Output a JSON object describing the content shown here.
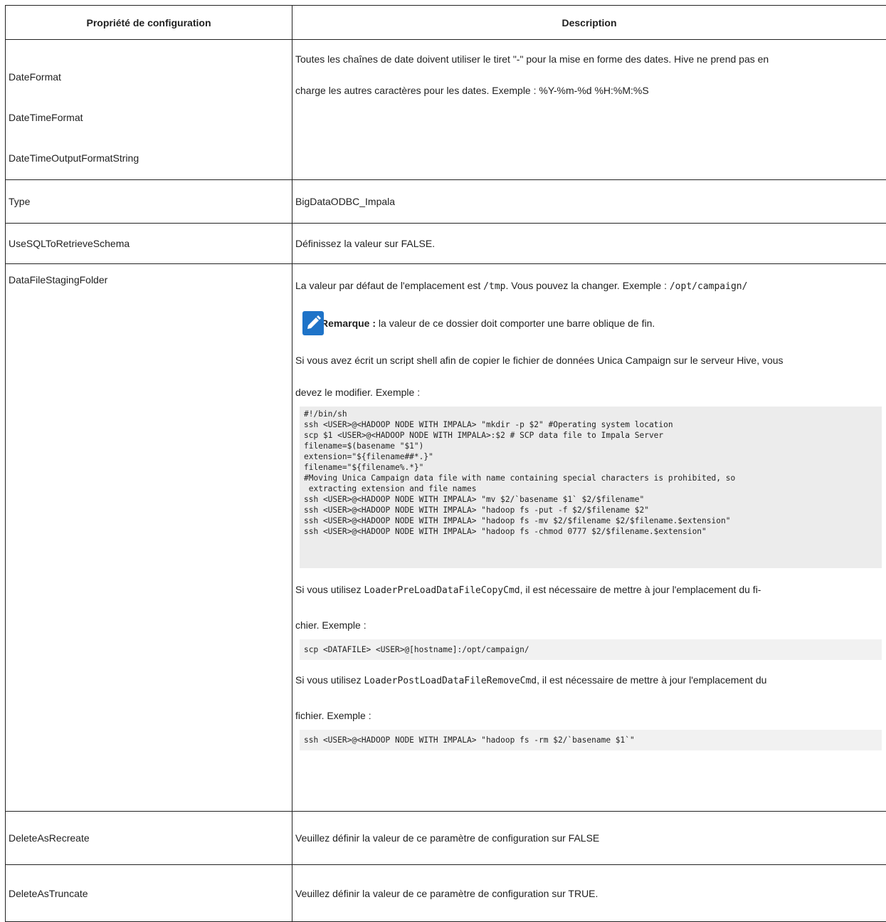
{
  "headers": {
    "property": "Propriété de configuration",
    "description": "Description"
  },
  "rows": {
    "date": {
      "names": [
        "DateFormat",
        "DateTimeFormat",
        "DateTimeOutputFormatString"
      ],
      "desc_line1": "Toutes les chaînes de date doivent utiliser le tiret \"-\" pour la mise en forme des dates. Hive ne prend pas en",
      "desc_line2": "charge les autres caractères pour les dates. Exemple : %Y-%m-%d %H:%M:%S"
    },
    "type": {
      "name": "Type",
      "desc": "BigDataODBC_Impala"
    },
    "usesql": {
      "name": "UseSQLToRetrieveSchema",
      "desc": "Définissez la valeur sur FALSE."
    },
    "staging": {
      "name": "DataFileStagingFolder",
      "line1_a": "La valeur par défaut de l'emplacement est ",
      "line1_code1": "/tmp",
      "line1_b": ". Vous pouvez la changer. Exemple : ",
      "line1_code2": "/opt/campaign/",
      "note_label": "Remarque :",
      "note_text": " la valeur de ce dossier doit comporter une barre oblique de fin.",
      "script_line1": "Si vous avez écrit un script shell afin de copier le fichier de données Unica Campaign sur le serveur Hive, vous",
      "script_line2": "devez le modifier. Exemple :",
      "code_lines": [
        "#!/bin/sh",
        "ssh <USER>@<HADOOP NODE WITH IMPALA> \"mkdir -p $2\" #Operating system location",
        "scp $1 <USER>@<HADOOP NODE WITH IMPALA>:$2 # SCP data file to Impala Server",
        "filename=$(basename \"$1\")",
        "extension=\"${filename##*.}\"",
        "filename=\"${filename%.*}\"",
        "#Moving Unica Campaign data file with name containing special characters is prohibited, so",
        " extracting extension and file names",
        "ssh <USER>@<HADOOP NODE WITH IMPALA> \"mv $2/`basename $1` $2/$filename\"",
        "ssh <USER>@<HADOOP NODE WITH IMPALA> \"hadoop fs -put -f $2/$filename $2\"",
        "ssh <USER>@<HADOOP NODE WITH IMPALA> \"hadoop fs -mv $2/$filename $2/$filename.$extension\"",
        "ssh <USER>@<HADOOP NODE WITH IMPALA> \"hadoop fs -chmod 0777 $2/$filename.$extension\""
      ],
      "pre_a": "Si vous utilisez ",
      "pre_code": "LoaderPreLoadDataFileCopyCmd",
      "pre_b": ", il est nécessaire de mettre à jour l'emplacement du fi-",
      "pre_line2": "chier. Exemple :",
      "pre_example": "scp <DATAFILE> <USER>@[hostname]:/opt/campaign/",
      "post_a": "Si vous utilisez ",
      "post_code": "LoaderPostLoadDataFileRemoveCmd",
      "post_b": ", il est nécessaire de mettre à jour l'emplacement du",
      "post_line2": "fichier. Exemple :",
      "post_example": "ssh <USER>@<HADOOP NODE WITH IMPALA> \"hadoop fs -rm $2/`basename $1`\""
    },
    "recreate": {
      "name": "DeleteAsRecreate",
      "desc": "Veuillez définir la valeur de ce paramètre de configuration sur FALSE"
    },
    "truncate": {
      "name": "DeleteAsTruncate",
      "desc": "Veuillez définir la valeur de ce paramètre de configuration sur TRUE."
    }
  },
  "colors": {
    "note_icon": "#1e73c8",
    "code_bg": "#ececec"
  },
  "icons": {
    "note": "pencil-icon"
  }
}
